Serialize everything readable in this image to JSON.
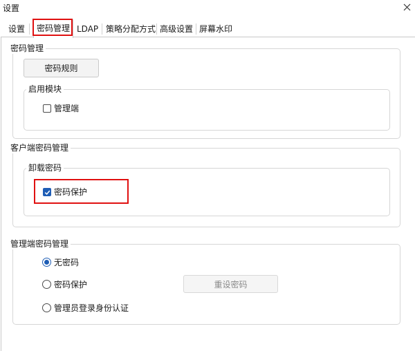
{
  "window": {
    "title": "设置",
    "close_icon": "close-icon"
  },
  "tabs": [
    {
      "label": "设置",
      "active": false
    },
    {
      "label": "密码管理",
      "active": true
    },
    {
      "label": "LDAP",
      "active": false
    },
    {
      "label": "策略分配方式",
      "active": false
    },
    {
      "label": "高级设置",
      "active": false
    },
    {
      "label": "屏幕水印",
      "active": false
    }
  ],
  "password_mgmt": {
    "group_label": "密码管理",
    "rules_button": "密码规则",
    "enable_module": {
      "group_label": "启用模块",
      "admin_checkbox_label": "管理端",
      "admin_checked": false
    }
  },
  "client_password": {
    "group_label": "客户端密码管理",
    "uninstall": {
      "group_label": "卸载密码",
      "protect_label": "密码保护",
      "protect_checked": true
    }
  },
  "admin_password": {
    "group_label": "管理端密码管理",
    "options": [
      {
        "label": "无密码",
        "selected": true
      },
      {
        "label": "密码保护",
        "selected": false
      },
      {
        "label": "管理员登录身份认证",
        "selected": false
      }
    ],
    "reset_button": "重设密码"
  },
  "colors": {
    "accent": "#1e5db5",
    "highlight": "#e01010"
  }
}
